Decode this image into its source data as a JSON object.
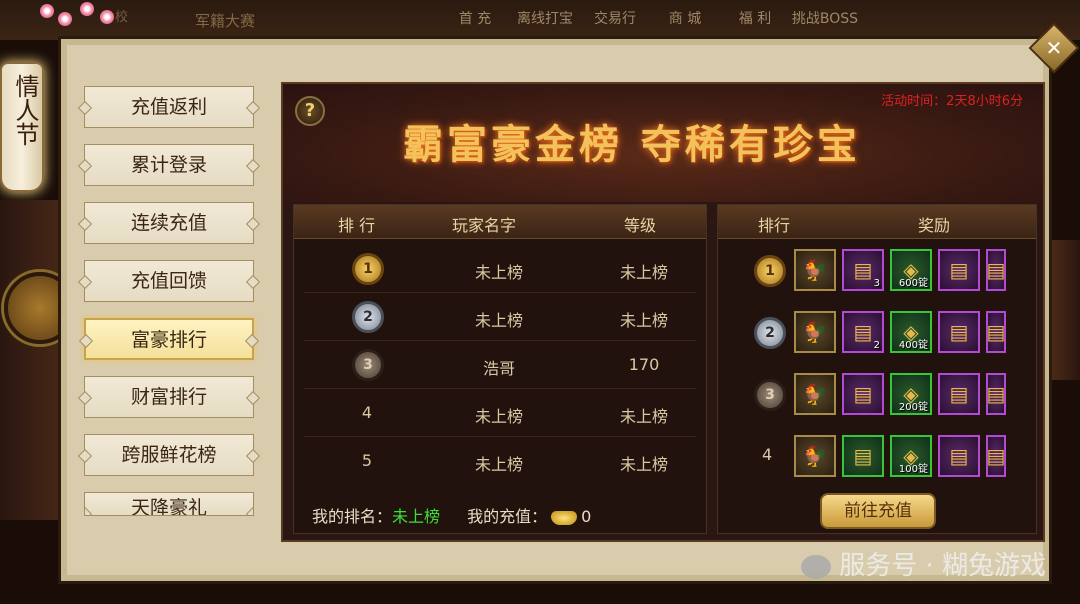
{
  "top_nav": {
    "partial_left": "校",
    "event_title": "军籍大赛",
    "items": [
      "首 充",
      "离线打宝",
      "交易行",
      "商 城",
      "福 利",
      "挑战BOSS"
    ]
  },
  "lantern_text": "情人节",
  "sidebar": {
    "items": [
      {
        "label": "充值返利",
        "active": false
      },
      {
        "label": "累计登录",
        "active": false
      },
      {
        "label": "连续充值",
        "active": false
      },
      {
        "label": "充值回馈",
        "active": false
      },
      {
        "label": "富豪排行",
        "active": true
      },
      {
        "label": "财富排行",
        "active": false
      },
      {
        "label": "跨服鲜花榜",
        "active": false
      },
      {
        "label": "天降豪礼",
        "active": false
      }
    ]
  },
  "banner": {
    "title": "霸富豪金榜  夺稀有珍宝",
    "help": "?",
    "timer_label": "活动时间：",
    "timer_value": "2天8小时6分"
  },
  "rank_table": {
    "headers": {
      "rank": "排 行",
      "name": "玩家名字",
      "level": "等级"
    },
    "rows": [
      {
        "rank": "1",
        "name": "未上榜",
        "level": "未上榜"
      },
      {
        "rank": "2",
        "name": "未上榜",
        "level": "未上榜"
      },
      {
        "rank": "3",
        "name": "浩哥",
        "level": "170"
      },
      {
        "rank": "4",
        "name": "未上榜",
        "level": "未上榜"
      },
      {
        "rank": "5",
        "name": "未上榜",
        "level": "未上榜"
      }
    ],
    "my_rank_label": "我的排名：",
    "my_rank_value": "未上榜",
    "my_recharge_label": "我的充值：",
    "my_recharge_value": "0"
  },
  "reward_table": {
    "headers": {
      "rank": "排行",
      "reward": "奖励"
    },
    "rows": [
      {
        "rank": "1",
        "items": [
          {
            "icon": "rooster",
            "style": "gold",
            "count": ""
          },
          {
            "icon": "book",
            "style": "purple",
            "count": "3"
          },
          {
            "icon": "silver",
            "style": "green",
            "count": "600锭"
          },
          {
            "icon": "book",
            "style": "purple",
            "count": ""
          },
          {
            "icon": "book",
            "style": "purple",
            "count": ""
          }
        ]
      },
      {
        "rank": "2",
        "items": [
          {
            "icon": "rooster",
            "style": "gold",
            "count": ""
          },
          {
            "icon": "book",
            "style": "purple",
            "count": "2"
          },
          {
            "icon": "silver",
            "style": "green",
            "count": "400锭"
          },
          {
            "icon": "book",
            "style": "purple",
            "count": ""
          },
          {
            "icon": "book",
            "style": "purple",
            "count": ""
          }
        ]
      },
      {
        "rank": "3",
        "items": [
          {
            "icon": "rooster",
            "style": "gold",
            "count": ""
          },
          {
            "icon": "book",
            "style": "purple",
            "count": ""
          },
          {
            "icon": "silver",
            "style": "green",
            "count": "200锭"
          },
          {
            "icon": "book",
            "style": "purple",
            "count": ""
          },
          {
            "icon": "book",
            "style": "purple",
            "count": ""
          }
        ]
      },
      {
        "rank": "4",
        "items": [
          {
            "icon": "rooster",
            "style": "gold",
            "count": ""
          },
          {
            "icon": "book",
            "style": "green",
            "count": ""
          },
          {
            "icon": "silver",
            "style": "green",
            "count": "100锭"
          },
          {
            "icon": "book",
            "style": "purple",
            "count": ""
          },
          {
            "icon": "book",
            "style": "purple",
            "count": ""
          }
        ]
      }
    ],
    "button_label": "前往充值"
  },
  "close_label": "✕",
  "watermark": "服务号 · 糊兔游戏"
}
